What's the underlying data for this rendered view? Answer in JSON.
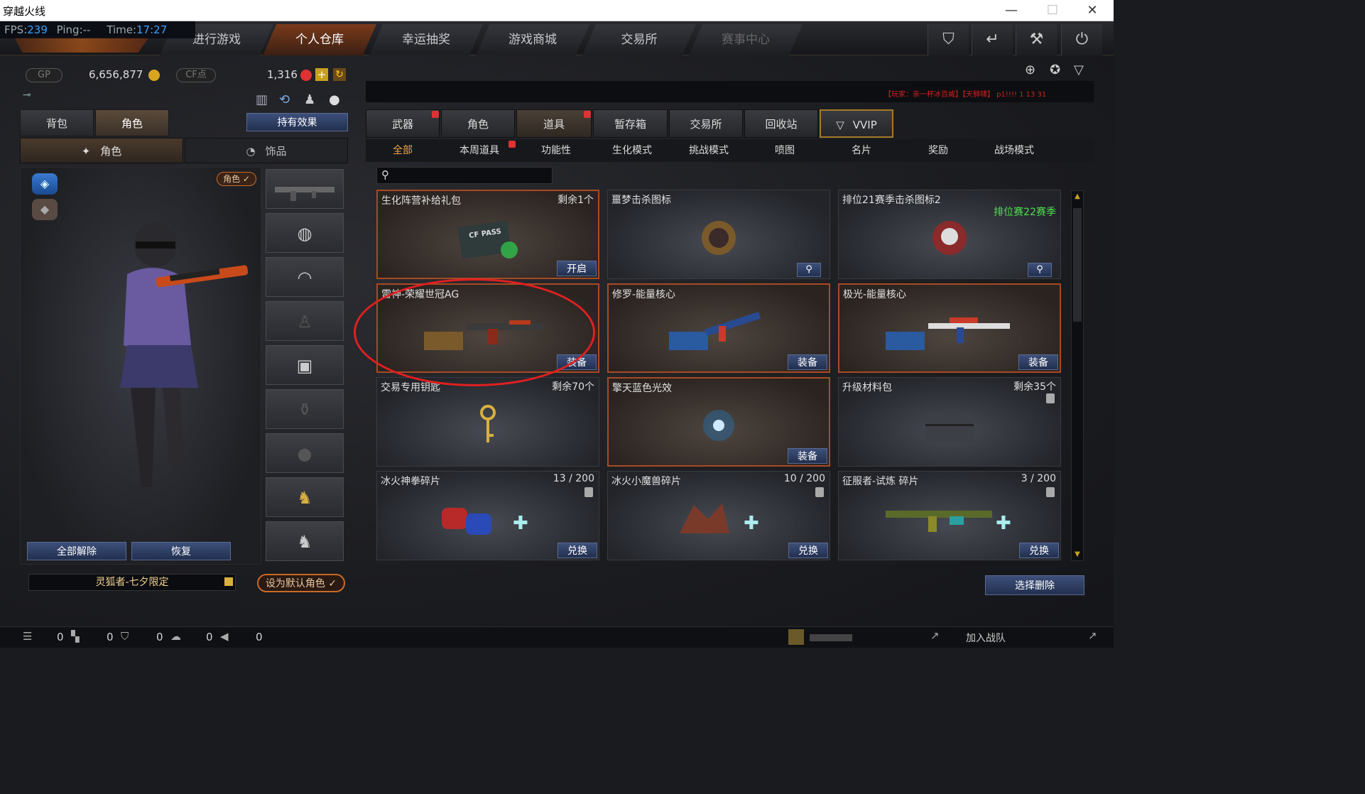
{
  "window": {
    "title": "穿越火线",
    "min": "—",
    "max": "☐",
    "close": "✕"
  },
  "hud": {
    "fps_label": "FPS:",
    "fps": "239",
    "ping": "Ping:--",
    "time_label": "Time:",
    "time": "17:27"
  },
  "nav": {
    "tabs": [
      "进行游戏",
      "个人仓库",
      "幸运抽奖",
      "游戏商城",
      "交易所",
      "赛事中心"
    ],
    "active": "个人仓库"
  },
  "currency": {
    "gp_label": "GP",
    "gp_value": "6,656,877",
    "cf_label": "CF点",
    "cf_value": "1,316"
  },
  "left": {
    "tabs": [
      "背包",
      "角色"
    ],
    "effects_button": "持有效果",
    "subtabs": [
      "角色",
      "饰品"
    ],
    "role_badge": "角色 ✓",
    "unequip_all": "全部解除",
    "restore": "恢复",
    "character_name": "灵狐者-七夕限定",
    "set_default": "设为默认角色 ✓"
  },
  "categories": {
    "tabs": [
      "武器",
      "角色",
      "道具",
      "暂存箱",
      "交易所",
      "回收站",
      "VVIP"
    ],
    "active": "道具"
  },
  "filters": {
    "items": [
      "全部",
      "本周道具",
      "功能性",
      "生化模式",
      "挑战模式",
      "喷图",
      "名片",
      "奖励",
      "战场模式"
    ],
    "active": "全部"
  },
  "ticker": "【玩家：亲一杯冰百威】【天狮啸】 p1!!!! 1 13 31",
  "items": [
    {
      "name": "生化阵营补给礼包",
      "qty": "剩余1个",
      "action": "开启",
      "highlight": true,
      "art": "PASS"
    },
    {
      "name": "噩梦击杀图标",
      "action_icon": "search",
      "art": "emblem"
    },
    {
      "name": "排位21赛季击杀图标2",
      "sub": "排位赛22赛季",
      "action_icon": "search",
      "art": "skull"
    },
    {
      "name": "雷神-荣耀世冠AG",
      "action": "装备",
      "highlight": true,
      "art": "rifle"
    },
    {
      "name": "修罗-能量核心",
      "action": "装备",
      "highlight": true,
      "art": "smg"
    },
    {
      "name": "极光-能量核心",
      "action": "装备",
      "highlight": true,
      "art": "sniper"
    },
    {
      "name": "交易专用钥匙",
      "qty": "剩余70个",
      "art": "key"
    },
    {
      "name": "擎天蓝色光效",
      "action": "装备",
      "highlight": true,
      "art": "glow"
    },
    {
      "name": "升级材料包",
      "qty": "剩余35个",
      "art": "case"
    },
    {
      "name": "冰火神拳碎片",
      "qty": "13 / 200",
      "action": "兑换",
      "art": "gloves"
    },
    {
      "name": "冰火小魔兽碎片",
      "qty": "10 / 200",
      "action": "兑换",
      "art": "beast"
    },
    {
      "name": "征服者-试炼 碎片",
      "qty": "3 / 200",
      "action": "兑换",
      "art": "gun"
    }
  ],
  "delete_button": "选择删除",
  "status": {
    "counts": [
      "0",
      "0",
      "0",
      "0",
      "0"
    ],
    "join_team": "加入战队"
  },
  "colors": {
    "accent": "#c86a2a",
    "highlight_border": "#a84a24",
    "annotation": "#e02020",
    "season_green": "#4ee04e"
  }
}
